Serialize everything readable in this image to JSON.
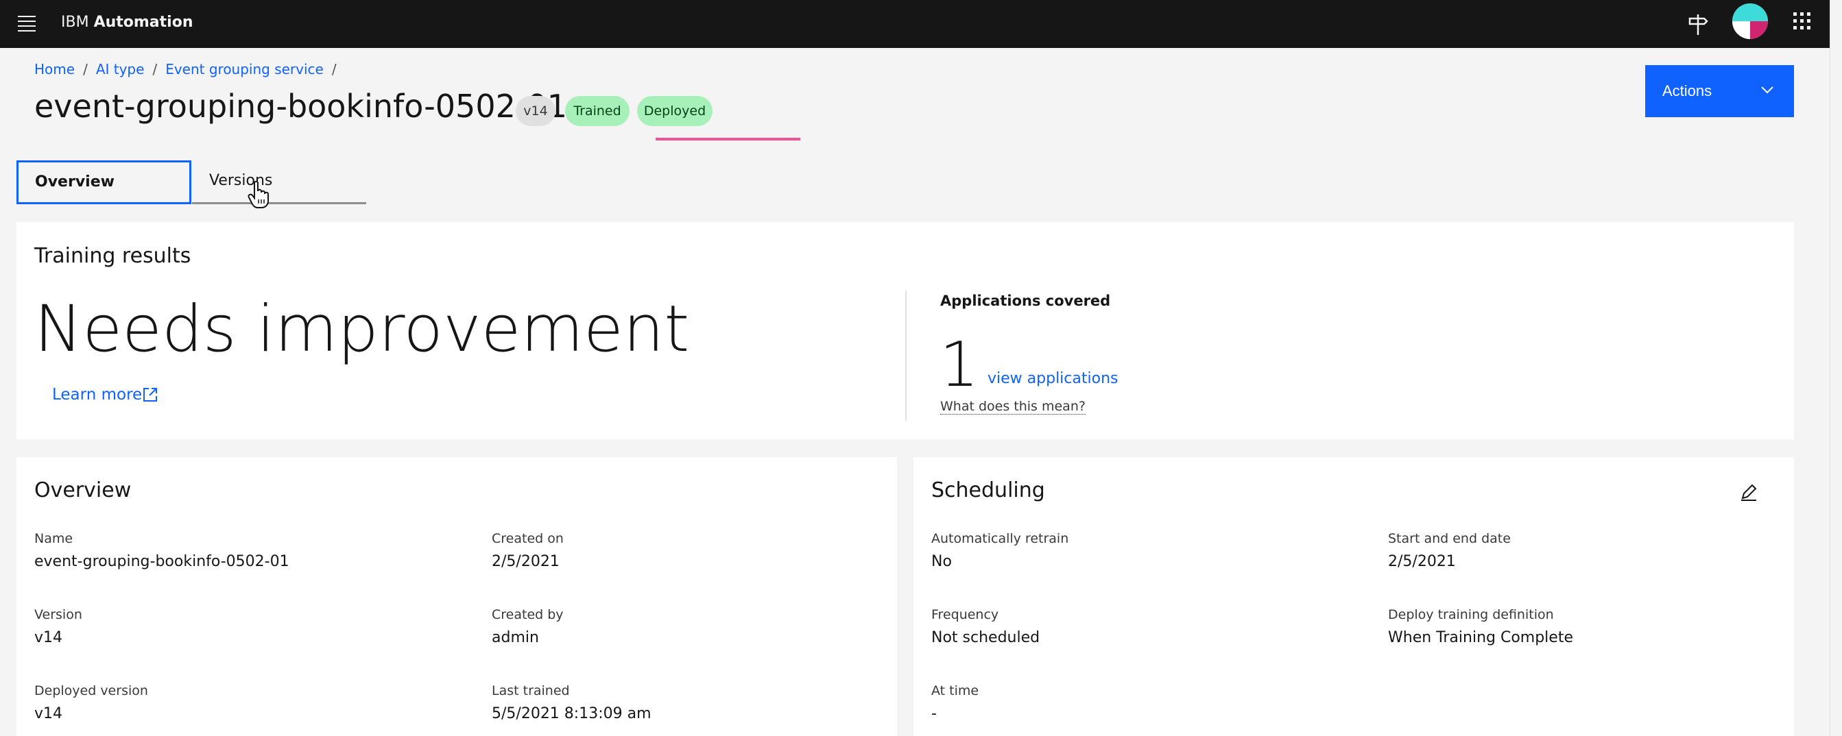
{
  "header": {
    "brand_prefix": "IBM",
    "brand_name": "Automation",
    "icons": [
      "menu-icon",
      "signpost-icon",
      "avatar",
      "app-switcher-icon"
    ]
  },
  "breadcrumb": {
    "items": [
      "Home",
      "AI type",
      "Event grouping service"
    ],
    "separator": "/"
  },
  "page": {
    "title": "event-grouping-bookinfo-0502-01",
    "tags": {
      "version": "v14",
      "trained": "Trained",
      "deployed": "Deployed"
    },
    "actions_label": "Actions"
  },
  "tabs": [
    "Overview",
    "Versions"
  ],
  "training": {
    "heading": "Training results",
    "status": "Needs improvement",
    "learn_more": "Learn more",
    "apps_heading": "Applications covered",
    "apps_count": "1",
    "view_apps": "view applications",
    "what_mean": "What does this mean?"
  },
  "overview": {
    "heading": "Overview",
    "fields": [
      {
        "label": "Name",
        "value": "event-grouping-bookinfo-0502-01"
      },
      {
        "label": "Created on",
        "value": "2/5/2021"
      },
      {
        "label": "Version",
        "value": "v14"
      },
      {
        "label": "Created by",
        "value": "admin"
      },
      {
        "label": "Deployed version",
        "value": "v14"
      },
      {
        "label": "Last trained",
        "value": "5/5/2021 8:13:09 am"
      }
    ]
  },
  "scheduling": {
    "heading": "Scheduling",
    "fields": [
      {
        "label": "Automatically retrain",
        "value": "No"
      },
      {
        "label": "Start and end date",
        "value": "2/5/2021"
      },
      {
        "label": "Frequency",
        "value": "Not scheduled"
      },
      {
        "label": "Deploy training definition",
        "value": "When Training Complete"
      },
      {
        "label": "At time",
        "value": "-"
      }
    ]
  },
  "colors": {
    "header_bg": "#161616",
    "accent": "#0f62fe",
    "tag_green": "#a7f0ba",
    "highlight": "#ee5396"
  }
}
